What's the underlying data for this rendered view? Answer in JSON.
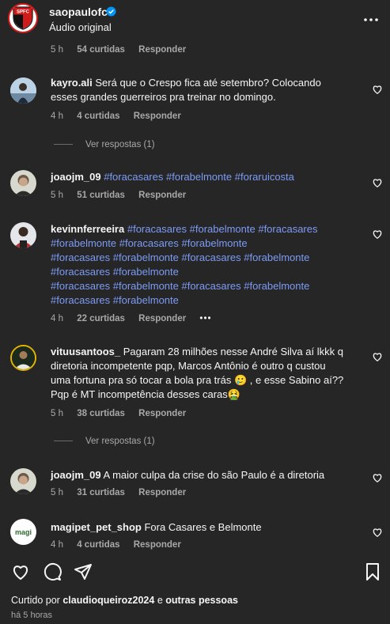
{
  "header": {
    "username": "saopaulofc",
    "subtitle": "Áudio original"
  },
  "top_meta": {
    "time": "5 h",
    "likes": "54 curtidas",
    "reply": "Responder"
  },
  "comments": [
    {
      "user": "kayro.ali",
      "text": "Será que o Crespo fica até setembro? Colocando esses grandes guerreiros pra treinar no domingo.",
      "time": "4 h",
      "likes": "4 curtidas",
      "reply": "Responder",
      "view_replies": "Ver respostas (1)"
    },
    {
      "user": "joaojm_09",
      "text_parts": [
        "#foracasares",
        "#forabelmonte",
        "#foraruicosta"
      ],
      "time": "5 h",
      "likes": "51 curtidas",
      "reply": "Responder"
    },
    {
      "user": "kevinnferreeira",
      "lines": [
        "#foracasares #forabelmonte #foracasares",
        "#forabelmonte #foracasares #forabelmonte",
        "#foracasares #forabelmonte #foracasares #forabelmonte",
        "#foracasares #forabelmonte",
        "#foracasares #forabelmonte #foracasares #forabelmonte",
        "#foracasares #forabelmonte"
      ],
      "time": "4 h",
      "likes": "22 curtidas",
      "reply": "Responder",
      "more": "•••"
    },
    {
      "user": "vituusantoos_",
      "text": "Pagaram 28 milhões nesse André Silva aí lkkk q diretoria incompetente pqp, Marcos Antônio é outro q custou uma fortuna pra só tocar a bola pra trás 🥲 , e esse Sabino aí?? Pqp é MT incompetência desses caras🤮",
      "time": "5 h",
      "likes": "38 curtidas",
      "reply": "Responder",
      "view_replies": "Ver respostas (1)"
    },
    {
      "user": "joaojm_09",
      "text": "A maior culpa da crise do são Paulo é a diretoria",
      "time": "5 h",
      "likes": "31 curtidas",
      "reply": "Responder"
    },
    {
      "user": "magipet_pet_shop",
      "text": "Fora Casares e Belmonte",
      "time": "4 h",
      "likes": "4 curtidas",
      "reply": "Responder",
      "avatar_text": "magi"
    }
  ],
  "footer": {
    "liked_prefix": "Curtido por",
    "liked_user": "claudioqueiroz2024",
    "liked_and": "e",
    "liked_others": "outras pessoas",
    "time_ago": "há 5 horas"
  },
  "colors": {
    "hashtag": "#7d9bf5",
    "verified": "#0095f6",
    "brand_red": "#d01b1b"
  }
}
